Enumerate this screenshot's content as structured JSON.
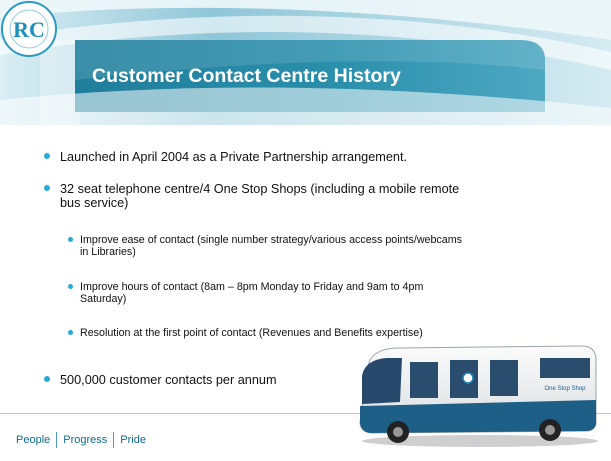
{
  "slide": {
    "title": "Customer Contact Centre History",
    "bullets": [
      "Launched in April 2004 as a Private Partnership arrangement.",
      "32 seat telephone centre/4 One Stop Shops (including a mobile remote bus service)",
      "500,000 customer contacts per annum"
    ],
    "sub_bullets": [
      "Improve ease of contact (single number strategy/various access points/webcams in Libraries)",
      "Improve hours of contact (8am – 8pm Monday to Friday and 9am to 4pm Saturday)",
      "Resolution at the first point of contact (Revenues and Benefits expertise)"
    ],
    "footer": [
      "People",
      "Progress",
      "Pride"
    ],
    "logo_letters": "RC",
    "bus_sign": "One Stop Shop"
  },
  "colors": {
    "accent": "#2aa8d8",
    "header_dark": "#1b6f8a",
    "footer_text": "#0e6c8e"
  }
}
